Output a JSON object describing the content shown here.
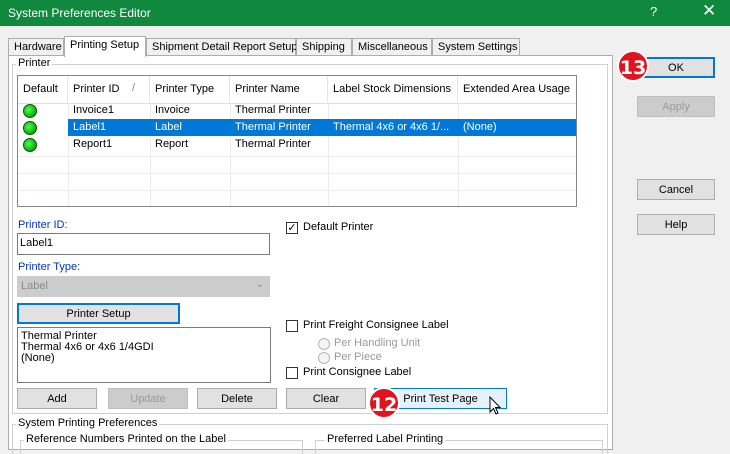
{
  "window": {
    "title": "System Preferences Editor",
    "help_glyph": "?",
    "close_glyph": "✕"
  },
  "tabs": [
    {
      "label": "Hardware"
    },
    {
      "label": "Printing Setup"
    },
    {
      "label": "Shipment Detail Report Setup"
    },
    {
      "label": "Shipping"
    },
    {
      "label": "Miscellaneous"
    },
    {
      "label": "System Settings"
    }
  ],
  "printer_group": {
    "label": "Printer"
  },
  "grid": {
    "columns": [
      "Default",
      "Printer ID",
      "Printer Type",
      "Printer Name",
      "Label Stock Dimensions",
      "Extended Area Usage"
    ],
    "sort_glyph": "/",
    "rows": [
      {
        "printer_id": "Invoice1",
        "printer_type": "Invoice",
        "printer_name": "Thermal Printer",
        "label_stock": "",
        "extended_area": ""
      },
      {
        "printer_id": "Label1",
        "printer_type": "Label",
        "printer_name": "Thermal Printer",
        "label_stock": "Thermal 4x6 or 4x6 1/...",
        "extended_area": "(None)"
      },
      {
        "printer_id": "Report1",
        "printer_type": "Report",
        "printer_name": "Thermal Printer",
        "label_stock": "",
        "extended_area": ""
      }
    ]
  },
  "form": {
    "printer_id_label": "Printer ID:",
    "printer_id_value": "Label1",
    "printer_type_label": "Printer Type:",
    "printer_type_value": "Label",
    "printer_setup_button": "Printer Setup",
    "info_lines": [
      "Thermal Printer",
      "Thermal 4x6 or 4x6 1/4GDI",
      "(None)"
    ],
    "default_printer_label": "Default Printer",
    "default_printer_checked": true,
    "freight_label": "Print Freight Consignee Label",
    "per_handling_unit": "Per Handling Unit",
    "per_piece": "Per Piece",
    "consignee_label": "Print Consignee Label"
  },
  "buttons": {
    "add": "Add",
    "update": "Update",
    "delete": "Delete",
    "clear": "Clear",
    "print_test": "Print Test Page",
    "ok": "OK",
    "apply": "Apply",
    "cancel": "Cancel",
    "help": "Help"
  },
  "bottom": {
    "system_printing": "System Printing Preferences",
    "reference_numbers": "Reference Numbers Printed on the Label",
    "preferred_label": "Preferred Label Printing"
  },
  "badges": {
    "ok_step": "13",
    "print_step": "12"
  },
  "colors": {
    "titlebar": "#10893e",
    "selection": "#0078d7",
    "badge": "#e0141e",
    "link_label": "#0033cc"
  }
}
